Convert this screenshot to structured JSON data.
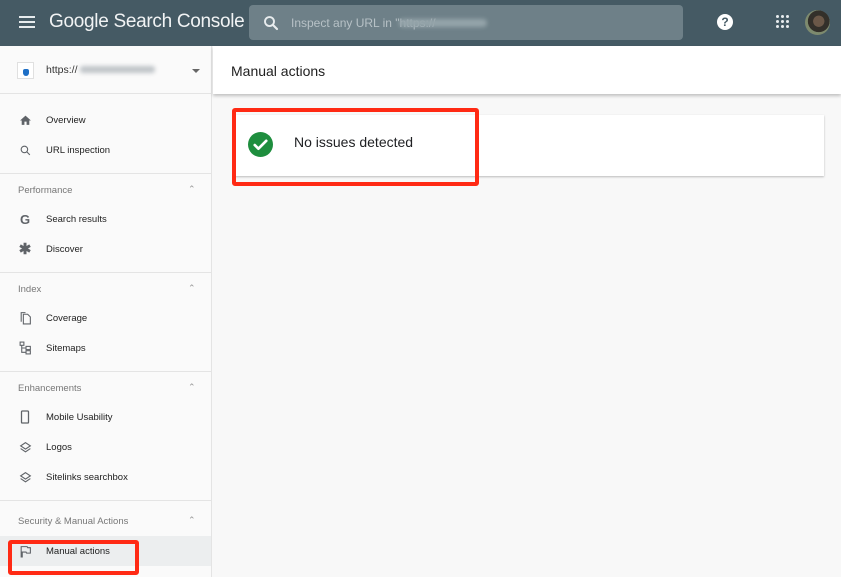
{
  "header": {
    "app_title": "Google Search Console",
    "search_placeholder": "Inspect any URL in \"https://",
    "icons": [
      "menu-icon",
      "search-icon",
      "help-icon",
      "apps-icon",
      "avatar"
    ]
  },
  "sidebar": {
    "property_url": "https://",
    "top_items": [
      {
        "label": "Overview",
        "icon": "home-icon"
      },
      {
        "label": "URL inspection",
        "icon": "search-icon"
      }
    ],
    "sections": [
      {
        "title": "Performance",
        "items": [
          {
            "label": "Search results",
            "icon": "google-g-icon"
          },
          {
            "label": "Discover",
            "icon": "asterisk-icon"
          }
        ]
      },
      {
        "title": "Index",
        "items": [
          {
            "label": "Coverage",
            "icon": "copy-pages-icon"
          },
          {
            "label": "Sitemaps",
            "icon": "sitemap-icon"
          }
        ]
      },
      {
        "title": "Enhancements",
        "items": [
          {
            "label": "Mobile Usability",
            "icon": "phone-icon"
          },
          {
            "label": "Logos",
            "icon": "layers-icon"
          },
          {
            "label": "Sitelinks searchbox",
            "icon": "layers-icon"
          }
        ]
      },
      {
        "title": "Security & Manual Actions",
        "items": [
          {
            "label": "Manual actions",
            "icon": "flag-icon",
            "active": true
          }
        ]
      }
    ]
  },
  "main": {
    "page_title": "Manual actions",
    "status": {
      "text": "No issues detected",
      "icon": "check-circle-icon",
      "color": "#1e8e3e"
    }
  },
  "annotations": {
    "highlight_color": "#ff2a14"
  }
}
